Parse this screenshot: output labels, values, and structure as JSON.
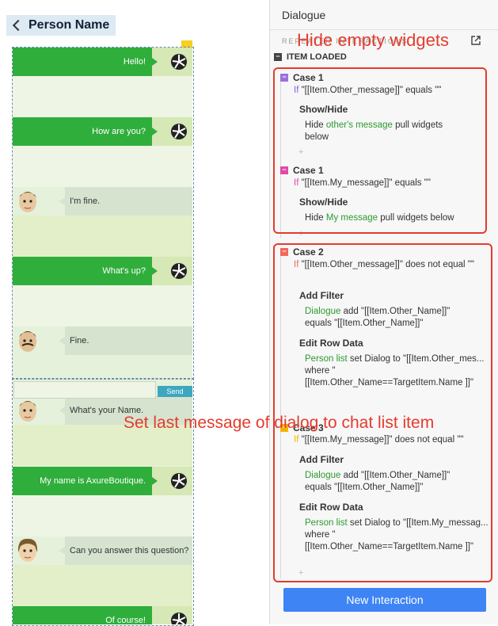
{
  "left": {
    "page_title": "Person Name",
    "messages": {
      "m1": "Hello!",
      "m2": "How are you?",
      "m3": "I'm fine.",
      "m4": "What's up?",
      "m5": "Fine.",
      "m6": "What's your Name.",
      "m7": "My name is AxureBoutique.",
      "m8": "Can you answer this question?",
      "m9": "Of course!"
    },
    "send_label": "Send"
  },
  "right": {
    "panel_title": "Dialogue",
    "section_label": "REPEATER INTERACTIONS",
    "item_loaded": "ITEM LOADED",
    "case1a": {
      "title": "Case 1",
      "if": "If",
      "cond": " \"[[Item.Other_message]]\" equals \"\"",
      "action_title": "Show/Hide",
      "a_pre": "Hide ",
      "a_target": "other's message",
      "a_post": "  pull widgets below"
    },
    "case1b": {
      "title": "Case 1",
      "if": "If",
      "cond": " \"[[Item.My_message]]\" equals \"\"",
      "action_title": "Show/Hide",
      "a_pre": "Hide ",
      "a_target": "My message",
      "a_post": "  pull widgets below"
    },
    "case2": {
      "title": "Case 2",
      "if": "If",
      "cond": " \"[[Item.Other_message]]\" does not equal \"\"",
      "act1_title": "Add Filter",
      "act1_target": "Dialogue",
      "act1_text": " add \"[[Item.Other_Name]]\" equals \"[[Item.Other_Name]]\"",
      "act2_title": "Edit Row Data",
      "act2_target": "Person list",
      "act2_text": " set Dialog to \"[[Item.Other_mes... where \"[[Item.Other_Name==TargetItem.Name ]]\""
    },
    "case3": {
      "title": "Case 3",
      "if": "If",
      "cond": " \"[[Item.My_message]]\" does not equal \"\"",
      "act1_title": "Add Filter",
      "act1_target": "Dialogue",
      "act1_text": " add \"[[Item.Other_Name]]\" equals \"[[Item.Other_Name]]\"",
      "act2_title": "Edit Row Data",
      "act2_target": "Person list",
      "act2_text": " set Dialog to \"[[Item.My_messag... where \"[[Item.Other_Name==TargetItem.Name ]]\""
    },
    "new_interaction": "New Interaction"
  },
  "annotations": {
    "top": "Hide empty widgets",
    "middle": "Set last message of dialog to chat list item"
  },
  "colors": {
    "green": "#2fae3b",
    "annotation_red": "#e53b2c",
    "primary_blue": "#3e84f5",
    "action_target_green": "#2d9a2d"
  }
}
